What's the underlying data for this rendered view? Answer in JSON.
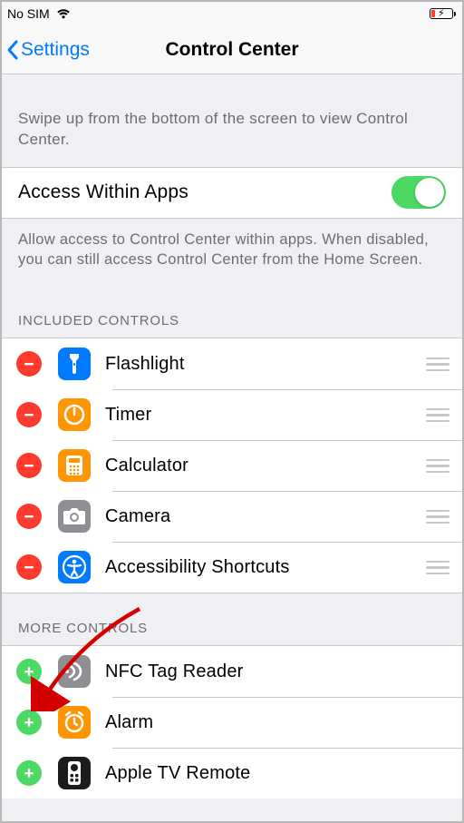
{
  "status": {
    "carrier": "No SIM"
  },
  "nav": {
    "back": "Settings",
    "title": "Control Center"
  },
  "help": {
    "intro": "Swipe up from the bottom of the screen to view Control Center.",
    "access_label": "Access Within Apps",
    "access_footer": "Allow access to Control Center within apps. When disabled, you can still access Control Center from the Home Screen."
  },
  "sections": {
    "included_header": "INCLUDED CONTROLS",
    "more_header": "MORE CONTROLS"
  },
  "included": [
    {
      "label": "Flashlight",
      "icon": "flashlight",
      "iconColor": "blue"
    },
    {
      "label": "Timer",
      "icon": "timer",
      "iconColor": "orange"
    },
    {
      "label": "Calculator",
      "icon": "calculator",
      "iconColor": "orange"
    },
    {
      "label": "Camera",
      "icon": "camera",
      "iconColor": "gray"
    },
    {
      "label": "Accessibility Shortcuts",
      "icon": "accessibility",
      "iconColor": "blue"
    }
  ],
  "more": [
    {
      "label": "NFC Tag Reader",
      "icon": "nfc",
      "iconColor": "gray"
    },
    {
      "label": "Alarm",
      "icon": "alarm",
      "iconColor": "orange"
    },
    {
      "label": "Apple TV Remote",
      "icon": "remote",
      "iconColor": "black"
    }
  ]
}
